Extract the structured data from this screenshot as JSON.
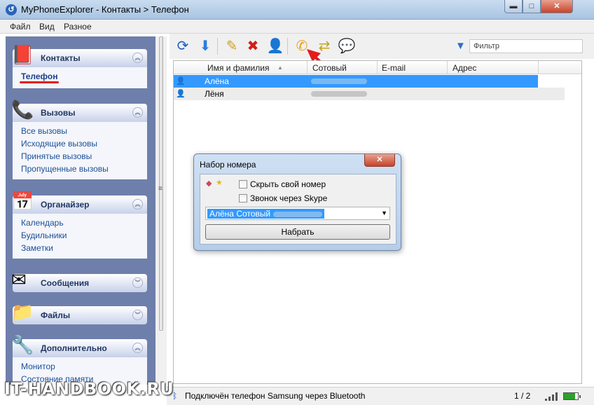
{
  "window": {
    "title": "MyPhoneExplorer -  Контакты > Телефон",
    "min": "▬",
    "max": "□",
    "close": "✕",
    "app_icon": "↺"
  },
  "menu": [
    "Файл",
    "Вид",
    "Разное"
  ],
  "sidebar": {
    "groups": [
      {
        "label": "Контакты",
        "chev": "︽",
        "items": [
          "Телефон"
        ],
        "active": "Телефон"
      },
      {
        "label": "Вызовы",
        "chev": "︽",
        "items": [
          "Все вызовы",
          "Исходящие вызовы",
          "Принятые вызовы",
          "Пропущенные вызовы"
        ]
      },
      {
        "label": "Органайзер",
        "chev": "︽",
        "items": [
          "Календарь",
          "Будильники",
          "Заметки"
        ]
      },
      {
        "label": "Сообщения",
        "chev": "︾",
        "items": []
      },
      {
        "label": "Файлы",
        "chev": "︾",
        "items": []
      },
      {
        "label": "Дополнительно",
        "chev": "︽",
        "items": [
          "Монитор",
          "Состояние памяти"
        ]
      }
    ]
  },
  "toolbar": {
    "buttons": [
      "refresh-icon",
      "download-icon",
      "edit-icon",
      "delete-icon",
      "add-contact-icon",
      "call-icon",
      "sync-icon",
      "message-icon"
    ],
    "filter_placeholder": "Фильтр"
  },
  "grid": {
    "columns": [
      "Имя и фамилия",
      "Сотовый",
      "E-mail",
      "Адрес"
    ],
    "sort_indicator": "▲",
    "rows": [
      {
        "name": "Алёна",
        "selected": true
      },
      {
        "name": "Лёня",
        "selected": false
      }
    ]
  },
  "dialog": {
    "title": "Набор номера",
    "close": "✕",
    "hide_number_label": "Скрыть свой номер",
    "skype_label": "Звонок через Skype",
    "combo_value": "Алёна Сотовый",
    "combo_arrow": "▼",
    "dial_button": "Набрать"
  },
  "status": {
    "text": "Подключён телефон Samsung через Bluetooth",
    "page": "1 / 2",
    "battery_level": 0.8
  },
  "watermark": "IT-HANDBOOK.RU",
  "colors": {
    "selection": "#3399ff",
    "sidebar_bg": "#6e7fab",
    "accent_red": "#e41b1b"
  }
}
